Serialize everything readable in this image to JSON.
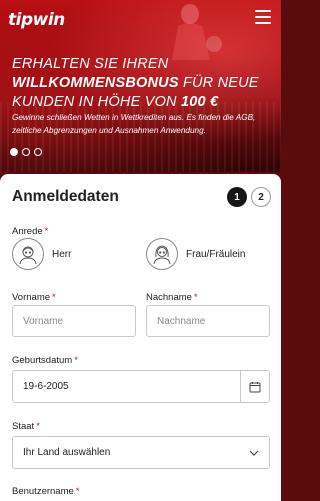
{
  "header": {
    "logo": "tipwin",
    "menu_icon": "hamburger-menu-icon"
  },
  "hero": {
    "headline_line1": "Erhalten Sie Ihren",
    "headline_bold": "Willkommensbonus",
    "headline_line2": " für neue",
    "headline_line3": "Kunden in Höhe von ",
    "headline_amount": "100 €",
    "subtext": "Gewinne schließen Wetten in Wettkrediten aus. Es finden die AGB, zeitliche Abgrenzungen und Ausnahmen Anwendung.",
    "carousel_total": 3,
    "carousel_active": 1
  },
  "form": {
    "title": "Anmeldedaten",
    "steps": [
      "1",
      "2"
    ],
    "active_step": 1,
    "required_mark": "*",
    "salutation_label": "Anrede",
    "salutation_options": [
      "Herr",
      "Frau/Fräulein"
    ],
    "first_name_label": "Vorname",
    "first_name_placeholder": "Vorname",
    "last_name_label": "Nachname",
    "last_name_placeholder": "Nachname",
    "birthdate_label": "Geburtsdatum",
    "birthdate_value": "19-6-2005",
    "country_label": "Staat",
    "country_value": "Ihr Land auswählen",
    "username_label": "Benutzername"
  },
  "colors": {
    "brand_red": "#b80f14",
    "required_red": "#d4121a",
    "step_active": "#161616"
  }
}
